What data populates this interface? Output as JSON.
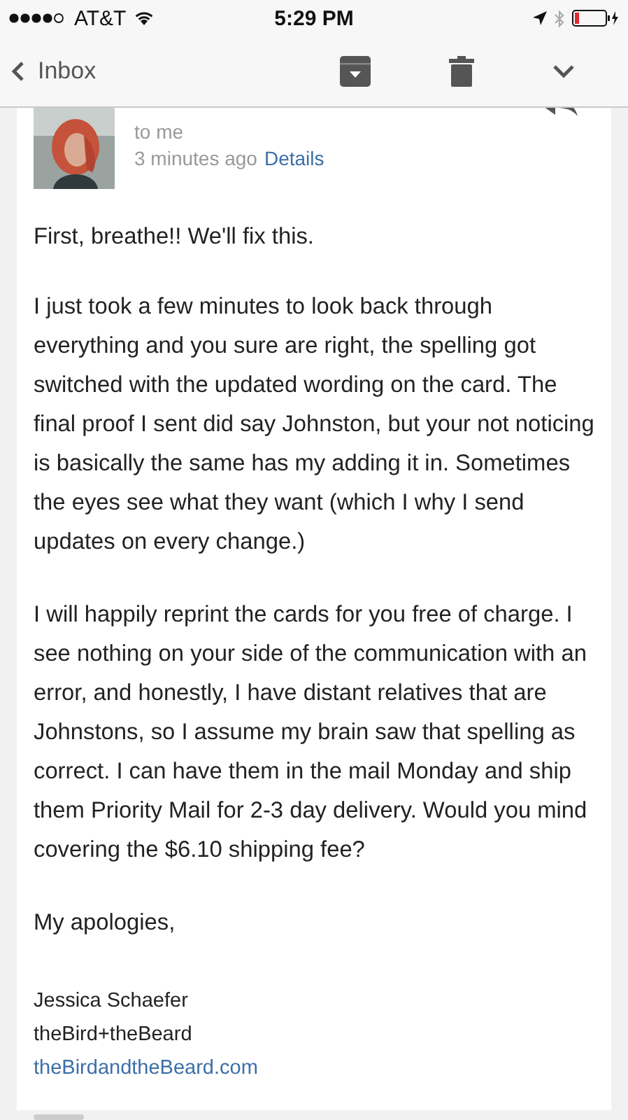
{
  "status_bar": {
    "carrier": "AT&T",
    "time": "5:29 PM"
  },
  "nav_bar": {
    "back_label": "Inbox"
  },
  "message": {
    "recipient": "to me",
    "time": "3 minutes ago",
    "details_link": "Details",
    "paragraphs": [
      "First, breathe!! We'll fix this.",
      "I just took a few minutes to look back through everything and you sure are right, the spelling got switched with the updated  wording on the card. The final proof I sent did say Johnston, but your not noticing is basically the same has my adding it in. Sometimes the eyes see what they want (which I why I send updates on every change.)",
      "I will happily reprint the cards for you free of charge. I see nothing on your side of the communication with an error, and honestly, I have distant relatives that are Johnstons, so I assume my brain saw that spelling as correct. I can have them in the mail Monday and ship them Priority Mail for 2-3 day delivery. Would you mind covering the $6.10 shipping fee?",
      "My apologies,"
    ],
    "signature": {
      "name": "Jessica Schaefer",
      "company": "theBird+theBeard",
      "website": "theBirdandtheBeard.com"
    }
  }
}
